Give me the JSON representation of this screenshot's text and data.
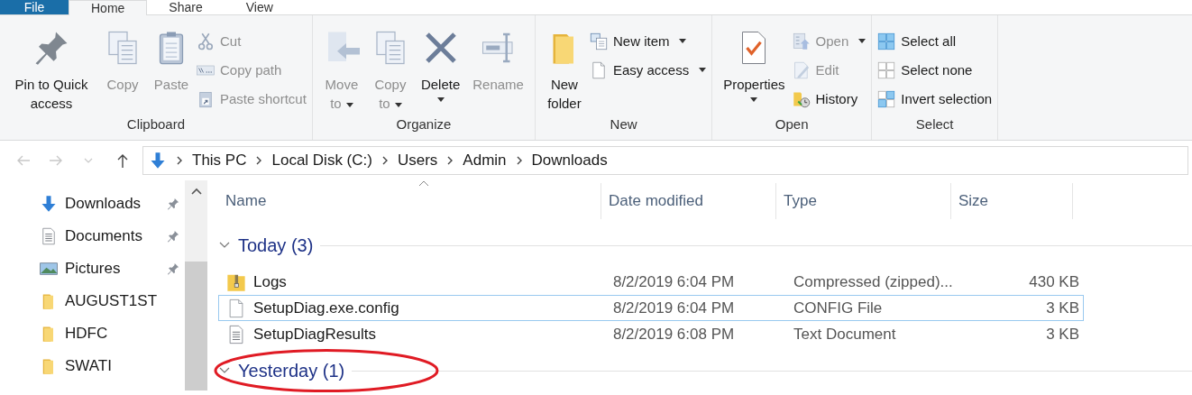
{
  "ribbon_tabs": [
    {
      "label": "File",
      "kind": "file",
      "selected": false
    },
    {
      "label": "Home",
      "kind": "tab",
      "selected": true
    },
    {
      "label": "Share",
      "kind": "tab",
      "selected": false
    },
    {
      "label": "View",
      "kind": "tab",
      "selected": false
    }
  ],
  "ribbon_groups": [
    {
      "label": "Clipboard",
      "items": [
        {
          "kind": "large",
          "label": "Pin to Quick access",
          "disabled": false,
          "dropdown": false
        },
        {
          "kind": "large",
          "label": "Copy",
          "disabled": true,
          "dropdown": false
        },
        {
          "kind": "large",
          "label": "Paste",
          "disabled": true,
          "dropdown": false
        },
        {
          "kind": "stack",
          "items": [
            {
              "label": "Cut",
              "disabled": true,
              "dropdown": false
            },
            {
              "label": "Copy path",
              "disabled": true,
              "dropdown": false
            },
            {
              "label": "Paste shortcut",
              "disabled": true,
              "dropdown": false
            }
          ]
        }
      ]
    },
    {
      "label": "Organize",
      "items": [
        {
          "kind": "large",
          "label": "Move to",
          "disabled": true,
          "dropdown": true
        },
        {
          "kind": "large",
          "label": "Copy to",
          "disabled": true,
          "dropdown": true
        },
        {
          "kind": "large",
          "label": "Delete",
          "disabled": false,
          "dropdown": true
        },
        {
          "kind": "large",
          "label": "Rename",
          "disabled": true,
          "dropdown": false
        }
      ]
    },
    {
      "label": "New",
      "items": [
        {
          "kind": "large",
          "label": "New folder",
          "disabled": false,
          "dropdown": false
        },
        {
          "kind": "stack",
          "items": [
            {
              "label": "New item",
              "disabled": false,
              "dropdown": true
            },
            {
              "label": "Easy access",
              "disabled": false,
              "dropdown": true
            }
          ]
        }
      ]
    },
    {
      "label": "Open",
      "items": [
        {
          "kind": "large",
          "label": "Properties",
          "disabled": false,
          "dropdown": true
        },
        {
          "kind": "stack",
          "items": [
            {
              "label": "Open",
              "disabled": true,
              "dropdown": true
            },
            {
              "label": "Edit",
              "disabled": true,
              "dropdown": false
            },
            {
              "label": "History",
              "disabled": false,
              "dropdown": false
            }
          ]
        }
      ]
    },
    {
      "label": "Select",
      "items": [
        {
          "kind": "stack",
          "items": [
            {
              "label": "Select all",
              "disabled": false,
              "dropdown": false
            },
            {
              "label": "Select none",
              "disabled": false,
              "dropdown": false
            },
            {
              "label": "Invert selection",
              "disabled": false,
              "dropdown": false
            }
          ]
        }
      ]
    }
  ],
  "nav": [
    {
      "kind": "back",
      "disabled": true
    },
    {
      "kind": "forward",
      "disabled": true
    },
    {
      "kind": "recent",
      "disabled": true
    },
    {
      "kind": "up",
      "disabled": false
    }
  ],
  "address": {
    "segments": [
      "This PC",
      "Local Disk (C:)",
      "Users",
      "Admin",
      "Downloads"
    ]
  },
  "sidebar": {
    "items": [
      {
        "label": "Downloads",
        "kind": "download",
        "pinned": true
      },
      {
        "label": "Documents",
        "kind": "document",
        "pinned": true
      },
      {
        "label": "Pictures",
        "kind": "picture",
        "pinned": true
      },
      {
        "label": "AUGUST1ST",
        "kind": "folder",
        "pinned": false
      },
      {
        "label": "HDFC",
        "kind": "folder",
        "pinned": false
      },
      {
        "label": "SWATI",
        "kind": "folder",
        "pinned": false
      }
    ]
  },
  "table": {
    "columns": [
      "Name",
      "Date modified",
      "Type",
      "Size"
    ],
    "groups": [
      {
        "label": "Today (3)",
        "expanded": true,
        "rows": [
          {
            "kind": "zip",
            "name": "Logs",
            "date": "8/2/2019 6:04 PM",
            "type": "Compressed (zipped)...",
            "size": "430 KB",
            "focused": false
          },
          {
            "kind": "config",
            "name": "SetupDiag.exe.config",
            "date": "8/2/2019 6:04 PM",
            "type": "CONFIG File",
            "size": "3 KB",
            "focused": true
          },
          {
            "kind": "text",
            "name": "SetupDiagResults",
            "date": "8/2/2019 6:08 PM",
            "type": "Text Document",
            "size": "3 KB",
            "focused": false
          }
        ]
      },
      {
        "label": "Yesterday (1)",
        "expanded": true
      }
    ]
  },
  "annotation": {
    "kind": "ellipse"
  }
}
